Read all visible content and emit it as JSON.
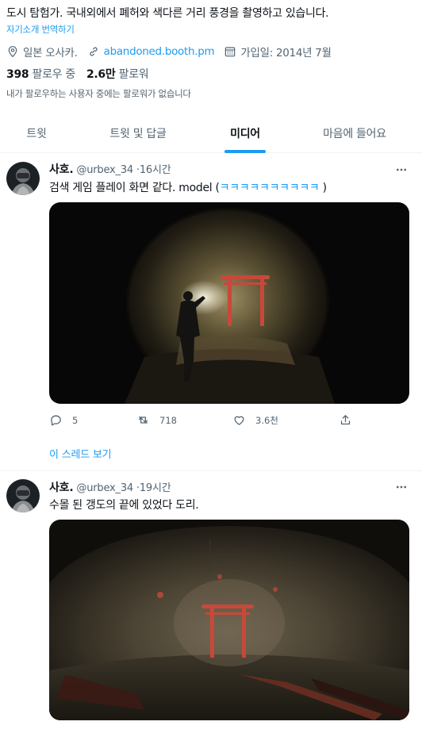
{
  "profile": {
    "bio": "도시 탐험가. 국내외에서 폐허와 색다른 거리 풍경을 촬영하고 있습니다.",
    "translate_label": "자기소개 번역하기",
    "location": "일본 오사카.",
    "website": "abandoned.booth.pm",
    "joined": "가입일: 2014년 7월",
    "following_count": "398",
    "following_label": "팔로우 중",
    "followers_count": "2.6만",
    "followers_label": "팔로워",
    "follow_note": "내가 팔로우하는 사용자 중에는 팔로워가 없습니다"
  },
  "tabs": [
    {
      "label": "트윗"
    },
    {
      "label": "트윗 및 답글"
    },
    {
      "label": "미디어"
    },
    {
      "label": "마음에 들어요"
    }
  ],
  "tweets": [
    {
      "name": "사호.",
      "handle": "@urbex_34",
      "time": "16시간",
      "text": "검색 게임 플레이 화면 같다. model (",
      "text_highlight": "ㅋㅋㅋㅋㅋㅋㅋㅋㅋㅋ",
      "text_end": ")",
      "replies": "5",
      "retweets": "718",
      "likes": "3.6천",
      "thread_label": "이 스레드 보기"
    },
    {
      "name": "사호.",
      "handle": "@urbex_34",
      "time": "19시간",
      "text": "수몰 된 갱도의 끝에 있었다 도리."
    }
  ],
  "colors": {
    "accent": "#1d9bf0",
    "text_primary": "#0f1419",
    "text_secondary": "#536471",
    "torii": "#c8483a"
  }
}
